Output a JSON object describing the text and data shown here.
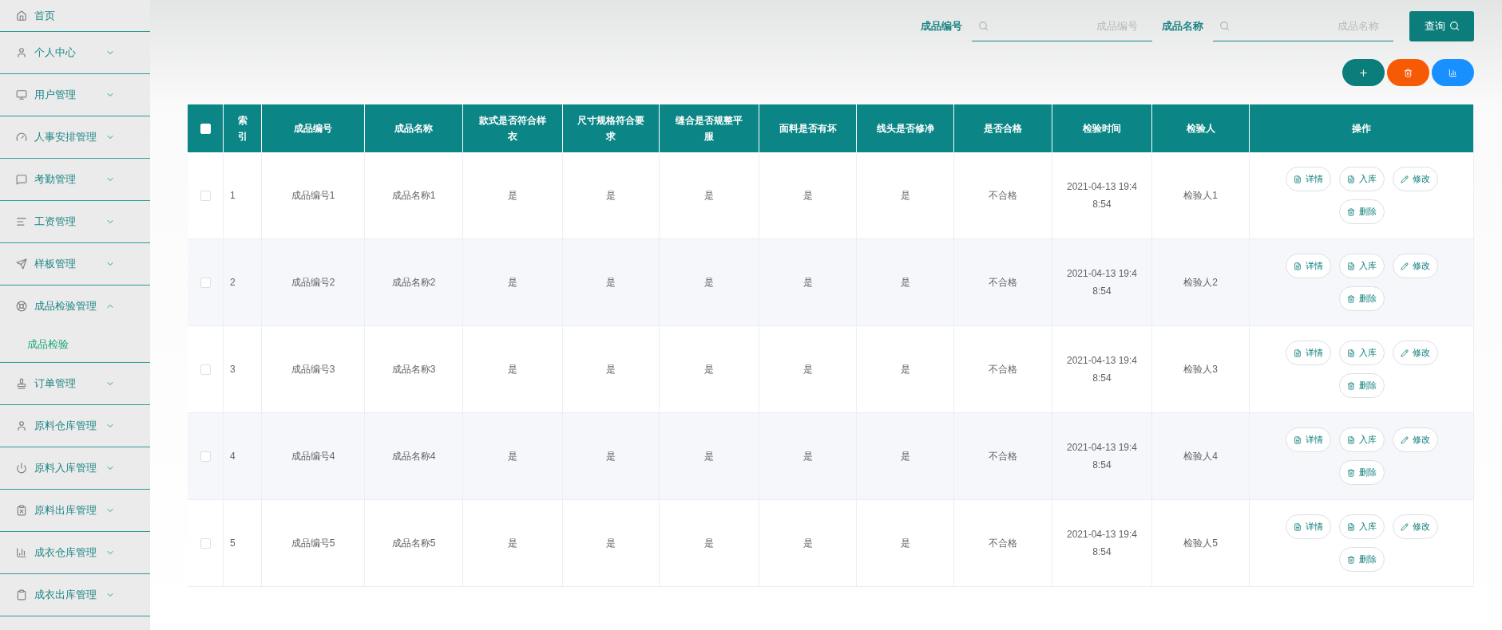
{
  "sidebar": {
    "items": [
      {
        "label": "首页",
        "kind": "link"
      },
      {
        "label": "个人中心",
        "kind": "menu",
        "expanded": false
      },
      {
        "label": "用户管理",
        "kind": "menu",
        "expanded": false
      },
      {
        "label": "人事安排管理",
        "kind": "menu",
        "expanded": false
      },
      {
        "label": "考勤管理",
        "kind": "menu",
        "expanded": false
      },
      {
        "label": "工资管理",
        "kind": "menu",
        "expanded": false
      },
      {
        "label": "样板管理",
        "kind": "menu",
        "expanded": false
      },
      {
        "label": "成品检验管理",
        "kind": "menu",
        "expanded": true,
        "children": [
          {
            "label": "成品检验",
            "selected": true
          }
        ]
      },
      {
        "label": "订单管理",
        "kind": "menu",
        "expanded": false
      },
      {
        "label": "原料仓库管理",
        "kind": "menu",
        "expanded": false
      },
      {
        "label": "原料入库管理",
        "kind": "menu",
        "expanded": false
      },
      {
        "label": "原料出库管理",
        "kind": "menu",
        "expanded": false
      },
      {
        "label": "成衣仓库管理",
        "kind": "menu",
        "expanded": false
      },
      {
        "label": "成衣出库管理",
        "kind": "menu",
        "expanded": false
      }
    ]
  },
  "search": {
    "fields": [
      {
        "label": "成品编号",
        "placeholder": "成品编号"
      },
      {
        "label": "成品名称",
        "placeholder": "成品名称"
      }
    ],
    "button": "查询"
  },
  "table": {
    "header_checked": false,
    "columns": [
      "索引",
      "成品编号",
      "成品名称",
      "款式是否符合样衣",
      "尺寸规格符合要求",
      "缝合是否规整平服",
      "面料是否有坏",
      "线头是否修净",
      "是否合格",
      "检验时间",
      "检验人",
      "操作"
    ],
    "rows": [
      {
        "checked": false,
        "cells": [
          "1",
          "成品编号1",
          "成品名称1",
          "是",
          "是",
          "是",
          "是",
          "是",
          "不合格",
          "2021-04-13 19:48:54",
          "检验人1"
        ],
        "actions": [
          "详情",
          "入库",
          "修改",
          "删除"
        ]
      },
      {
        "checked": false,
        "cells": [
          "2",
          "成品编号2",
          "成品名称2",
          "是",
          "是",
          "是",
          "是",
          "是",
          "不合格",
          "2021-04-13 19:48:54",
          "检验人2"
        ],
        "actions": [
          "详情",
          "入库",
          "修改",
          "删除"
        ]
      },
      {
        "checked": false,
        "cells": [
          "3",
          "成品编号3",
          "成品名称3",
          "是",
          "是",
          "是",
          "是",
          "是",
          "不合格",
          "2021-04-13 19:48:54",
          "检验人3"
        ],
        "actions": [
          "详情",
          "入库",
          "修改",
          "删除"
        ]
      },
      {
        "checked": false,
        "cells": [
          "4",
          "成品编号4",
          "成品名称4",
          "是",
          "是",
          "是",
          "是",
          "是",
          "不合格",
          "2021-04-13 19:48:54",
          "检验人4"
        ],
        "actions": [
          "详情",
          "入库",
          "修改",
          "删除"
        ]
      },
      {
        "checked": false,
        "cells": [
          "5",
          "成品编号5",
          "成品名称5",
          "是",
          "是",
          "是",
          "是",
          "是",
          "不合格",
          "2021-04-13 19:48:54",
          "检验人5"
        ],
        "actions": [
          "详情",
          "入库",
          "修改",
          "删除"
        ]
      }
    ]
  }
}
